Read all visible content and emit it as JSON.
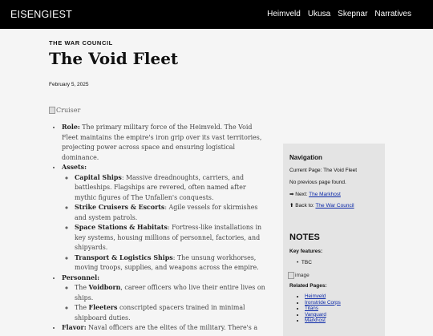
{
  "header": {
    "brand": "EISENGIEST",
    "nav": [
      "Heimveld",
      "Ukusa",
      "Skepnar",
      "Narratives"
    ]
  },
  "article": {
    "eyebrow": "THE WAR COUNCIL",
    "title": "The Void Fleet",
    "date": "February 5, 2025",
    "image_alt": "Cruiser"
  },
  "content": {
    "role_label": "Role:",
    "role_text": " The primary military force of the Heimveld. The Void Fleet maintains the empire's iron grip over its vast territories, projecting power across space and ensuring logistical dominance.",
    "assets_label": "Assets:",
    "assets": [
      {
        "label": "Capital Ships",
        "text": ": Massive dreadnoughts, carriers, and battleships. Flagships are revered, often named after mythic figures of The Unfallen's conquests."
      },
      {
        "label": "Strike Cruisers & Escorts",
        "text": ": Agile vessels for skirmishes and system patrols."
      },
      {
        "label": "Space Stations & Habitats",
        "text": ": Fortress-like installations in key systems, housing millions of personnel, factories, and shipyards."
      },
      {
        "label": "Transport & Logistics Ships",
        "text": ": The unsung workhorses, moving troops, supplies, and weapons across the empire."
      }
    ],
    "personnel_label": "Personnel:",
    "personnel": [
      {
        "pre": "The ",
        "label": "Voidborn",
        "text": ", career officers who live their entire lives on ships."
      },
      {
        "pre": "The ",
        "label": "Fleeters",
        "text": " conscripted spacers trained in minimal shipboard duties."
      }
    ],
    "flavor_label": "Flavor:",
    "flavor_text": " Naval officers are the elites of the military. There's a"
  },
  "sidebar": {
    "nav_heading": "Navigation",
    "current_page": "Current Page: The Void Fleet",
    "no_previous": "No previous page found.",
    "next_prefix": "➡ Next: ",
    "next_link": "The Markhost",
    "back_prefix": "⬆ Back to: ",
    "back_link": "The War Council",
    "notes_heading": "NOTES",
    "key_features_heading": "Key features:",
    "key_features": [
      "TBC"
    ],
    "image_alt": "image",
    "related_heading": "Related Pages:",
    "related": [
      "Heimveld",
      "Ironstride Corps",
      "Titans",
      "Vanguard",
      "Markhost"
    ]
  }
}
